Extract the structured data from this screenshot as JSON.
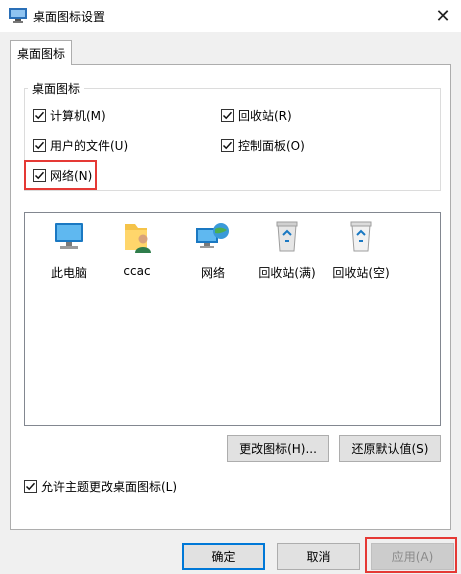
{
  "window": {
    "title": "桌面图标设置"
  },
  "tab": {
    "label": "桌面图标"
  },
  "group": {
    "legend": "桌面图标",
    "checkboxes": [
      {
        "label": "计算机(M)",
        "checked": true
      },
      {
        "label": "回收站(R)",
        "checked": true
      },
      {
        "label": "用户的文件(U)",
        "checked": true
      },
      {
        "label": "控制面板(O)",
        "checked": true
      },
      {
        "label": "网络(N)",
        "checked": true
      }
    ]
  },
  "icons": [
    {
      "label": "此电脑",
      "icon": "computer-icon"
    },
    {
      "label": "ccac",
      "icon": "user-folder-icon"
    },
    {
      "label": "网络",
      "icon": "network-icon"
    },
    {
      "label": "回收站(满)",
      "icon": "recycle-bin-full-icon"
    },
    {
      "label": "回收站(空)",
      "icon": "recycle-bin-empty-icon"
    }
  ],
  "buttons": {
    "change_icon": "更改图标(H)...",
    "restore_default": "还原默认值(S)",
    "ok": "确定",
    "cancel": "取消",
    "apply": "应用(A)"
  },
  "allow_theme": {
    "label": "允许主题更改桌面图标(L)",
    "checked": true
  },
  "colors": {
    "highlight": "#e53935",
    "accent": "#0078d7"
  }
}
